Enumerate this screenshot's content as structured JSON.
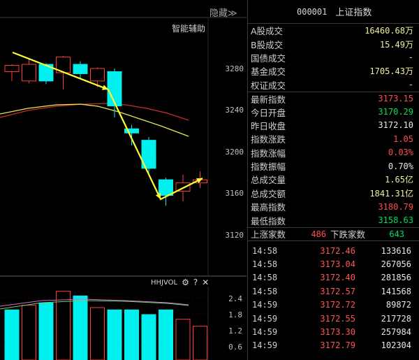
{
  "chart": {
    "hide_label": "隐藏",
    "hide_chevron": "≫",
    "assist_label": "智能辅助",
    "price_ticks": [
      "3280",
      "3240",
      "3200",
      "3160",
      "3120"
    ],
    "volume": {
      "indicator": "HHJVOL",
      "help": "?",
      "close": "✕",
      "ticks": [
        "2.4",
        "1.8",
        "1.2",
        "0.6"
      ]
    },
    "colors": {
      "up": "#ff3b3b",
      "down": "#00f0f0",
      "ma_yellow": "#e8e84a",
      "ma_red": "#d22a2a",
      "arrow": "#ffff33"
    }
  },
  "quote": {
    "code": "000001",
    "name": "上证指数",
    "rows": [
      {
        "label": "A股成交",
        "value": "16460.68万",
        "color": "yellow"
      },
      {
        "label": "B股成交",
        "value": "15.49万",
        "color": "yellow"
      },
      {
        "label": "国债成交",
        "value": "-",
        "color": "white"
      },
      {
        "label": "基金成交",
        "value": "1705.43万",
        "color": "yellow"
      },
      {
        "label": "权证成交",
        "value": "-",
        "color": "white"
      },
      {
        "label": "最新指数",
        "value": "3173.15",
        "color": "red"
      },
      {
        "label": "今日开盘",
        "value": "3170.29",
        "color": "green"
      },
      {
        "label": "昨日收盘",
        "value": "3172.10",
        "color": "white"
      },
      {
        "label": "指数涨跌",
        "value": "1.05",
        "color": "red"
      },
      {
        "label": "指数涨幅",
        "value": "0.03%",
        "color": "red"
      },
      {
        "label": "指数振幅",
        "value": "0.70%",
        "color": "white"
      },
      {
        "label": "总成交量",
        "value": "1.65亿",
        "color": "yellow"
      },
      {
        "label": "总成交额",
        "value": "1841.31亿",
        "color": "yellow"
      },
      {
        "label": "最高指数",
        "value": "3180.79",
        "color": "red"
      },
      {
        "label": "最低指数",
        "value": "3158.63",
        "color": "green"
      }
    ],
    "up_label": "上涨家数",
    "up_count": "486",
    "down_label": "下跌家数",
    "down_count": "643",
    "ticks": [
      {
        "time": "14:58",
        "price": "3172.46",
        "vol": "133616"
      },
      {
        "time": "14:58",
        "price": "3173.04",
        "vol": "267056"
      },
      {
        "time": "14:58",
        "price": "3172.40",
        "vol": "281856"
      },
      {
        "time": "14:58",
        "price": "3172.57",
        "vol": "141568"
      },
      {
        "time": "14:59",
        "price": "3172.72",
        "vol": "89872"
      },
      {
        "time": "14:59",
        "price": "3172.55",
        "vol": "217728"
      },
      {
        "time": "14:59",
        "price": "3173.30",
        "vol": "257984"
      },
      {
        "time": "14:59",
        "price": "3172.79",
        "vol": "102304"
      }
    ]
  },
  "candles": [
    {
      "o": 3277,
      "h": 3284,
      "l": 3268,
      "c": 3283
    },
    {
      "o": 3268,
      "h": 3290,
      "l": 3266,
      "c": 3284
    },
    {
      "o": 3284,
      "h": 3285,
      "l": 3265,
      "c": 3268
    },
    {
      "o": 3276,
      "h": 3292,
      "l": 3260,
      "c": 3291
    },
    {
      "o": 3284,
      "h": 3287,
      "l": 3270,
      "c": 3275
    },
    {
      "o": 3268,
      "h": 3281,
      "l": 3262,
      "c": 3280
    },
    {
      "o": 3277,
      "h": 3280,
      "l": 3233,
      "c": 3244
    },
    {
      "o": 3222,
      "h": 3226,
      "l": 3206,
      "c": 3218
    },
    {
      "o": 3211,
      "h": 3214,
      "l": 3179,
      "c": 3184
    },
    {
      "o": 3173,
      "h": 3175,
      "l": 3148,
      "c": 3158
    },
    {
      "o": 3162,
      "h": 3178,
      "l": 3152,
      "c": 3170
    },
    {
      "o": 3170,
      "h": 3181,
      "l": 3165,
      "c": 3173
    }
  ],
  "volumes": [
    {
      "v": 2.0,
      "dir": "down"
    },
    {
      "v": 2.2,
      "dir": "up"
    },
    {
      "v": 2.3,
      "dir": "down"
    },
    {
      "v": 2.8,
      "dir": "up"
    },
    {
      "v": 2.6,
      "dir": "down"
    },
    {
      "v": 2.1,
      "dir": "up"
    },
    {
      "v": 2.0,
      "dir": "down"
    },
    {
      "v": 2.0,
      "dir": "down"
    },
    {
      "v": 1.8,
      "dir": "down"
    },
    {
      "v": 2.0,
      "dir": "down"
    },
    {
      "v": 1.6,
      "dir": "up"
    },
    {
      "v": 1.3,
      "dir": "up"
    }
  ]
}
